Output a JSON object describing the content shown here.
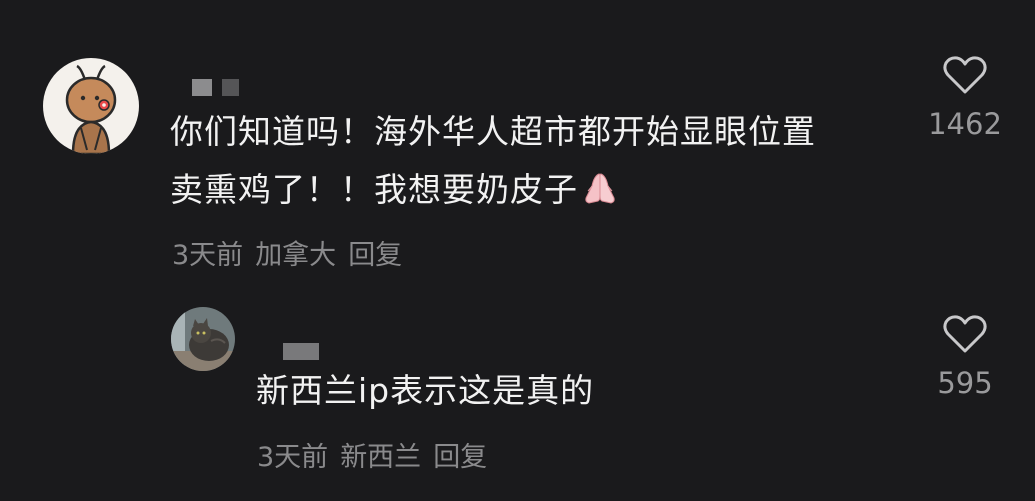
{
  "comments": [
    {
      "line1": "你们知道吗！海外华人超市都开始显眼位置",
      "line2": "卖熏鸡了！！我想要奶皮子",
      "emoji": "folded-hands",
      "time": "3天前",
      "location": "加拿大",
      "reply": "回复",
      "likes": "1462"
    },
    {
      "line1": "新西兰ip表示这是真的",
      "time": "3天前",
      "location": "新西兰",
      "reply": "回复",
      "likes": "595"
    }
  ],
  "icons": {
    "like": "heart-outline-icon",
    "avatar1": "cartoon-character-avatar",
    "avatar2": "cat-photo-avatar"
  },
  "colors": {
    "background": "#1a1a1c",
    "text": "#f2f2f2",
    "meta": "#8a8a8c"
  }
}
